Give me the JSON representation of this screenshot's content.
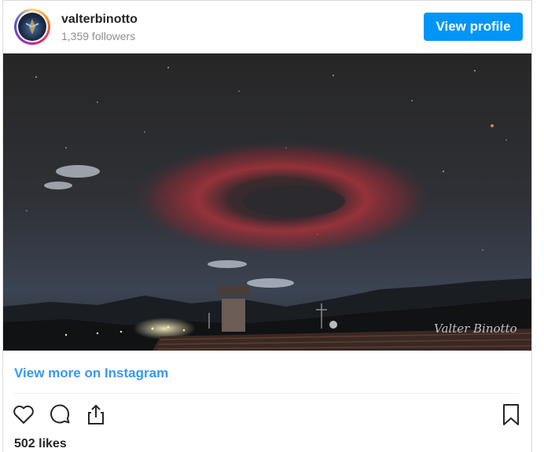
{
  "post": {
    "username": "valterbinotto",
    "followers": "1,359 followers",
    "view_profile_label": "View profile",
    "photo_signature": "Valter Binotto",
    "view_more_label": "View more on Instagram",
    "likes": "502 likes"
  },
  "icons": {
    "like": "heart-icon",
    "comment": "comment-icon",
    "share": "share-icon",
    "save": "bookmark-icon"
  },
  "colors": {
    "accent": "#0095f6",
    "link": "#3897f0",
    "aurora": "#c8323c"
  }
}
